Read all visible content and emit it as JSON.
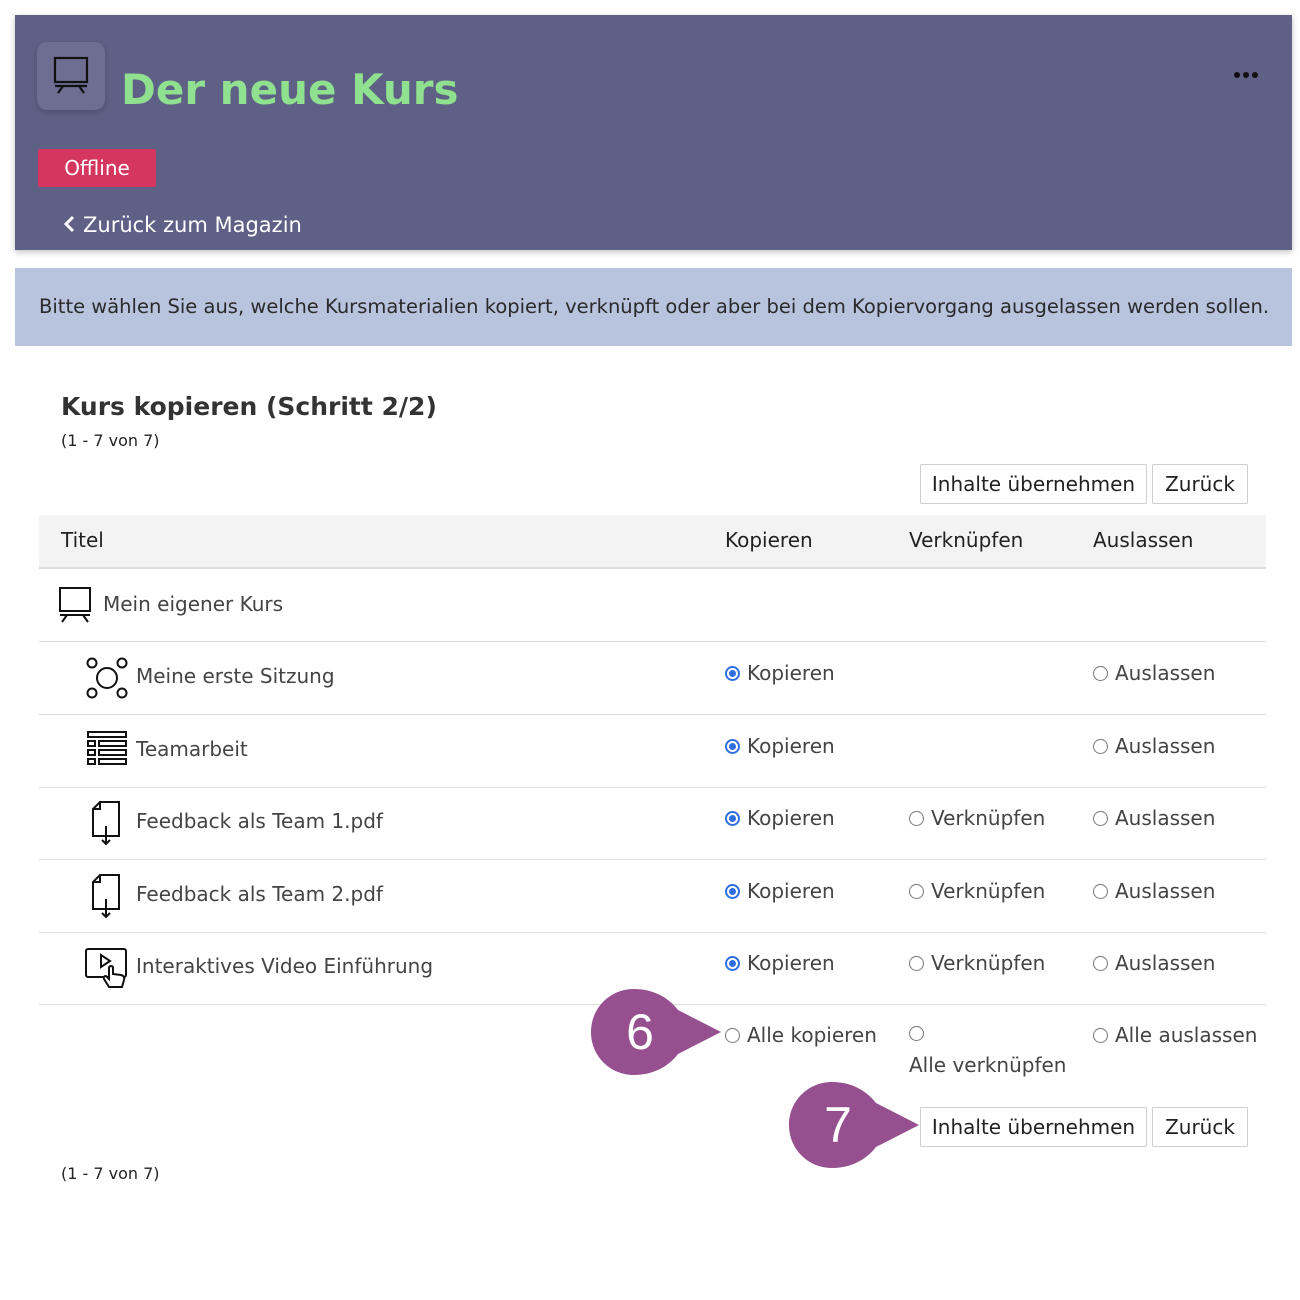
{
  "header": {
    "title": "Der neue Kurs",
    "status_badge": "Offline",
    "back_link": "Zurück zum Magazin",
    "more_icon": "more-horizontal-icon",
    "course_icon": "presentation-board-icon",
    "colors": {
      "background": "#5f6085",
      "title": "#8fe08f",
      "badge": "#d4365f"
    }
  },
  "info_message": "Bitte wählen Sie aus, welche Kursmaterialien kopiert, verknüpft oder aber bei dem Kopiervorgang ausgelassen werden sollen.",
  "page": {
    "heading": "Kurs kopieren (Schritt 2/2)",
    "count_top": "(1 - 7 von 7)",
    "count_bottom": "(1 - 7 von 7)"
  },
  "buttons": {
    "apply": "Inhalte übernehmen",
    "back": "Zurück"
  },
  "table": {
    "columns": [
      "Titel",
      "Kopieren",
      "Verknüpfen",
      "Auslassen"
    ],
    "rows": [
      {
        "title": "Mein eigener Kurs",
        "icon": "presentation-board-icon"
      },
      {
        "title": "Meine erste Sitzung",
        "icon": "session-network-icon",
        "options": [
          "Kopieren",
          "Auslassen"
        ],
        "selected": "Kopieren"
      },
      {
        "title": "Teamarbeit",
        "icon": "list-table-icon",
        "options": [
          "Kopieren",
          "Auslassen"
        ],
        "selected": "Kopieren"
      },
      {
        "title": "Feedback als Team 1.pdf",
        "icon": "file-download-icon",
        "options": [
          "Kopieren",
          "Verknüpfen",
          "Auslassen"
        ],
        "selected": "Kopieren"
      },
      {
        "title": "Feedback als Team 2.pdf",
        "icon": "file-download-icon",
        "options": [
          "Kopieren",
          "Verknüpfen",
          "Auslassen"
        ],
        "selected": "Kopieren"
      },
      {
        "title": "Interaktives Video Einführung",
        "icon": "interactive-video-icon",
        "options": [
          "Kopieren",
          "Verknüpfen",
          "Auslassen"
        ],
        "selected": "Kopieren"
      }
    ],
    "bulk": {
      "copy_all": "Alle kopieren",
      "link_all": "Alle verknüpfen",
      "skip_all": "Alle auslassen"
    }
  },
  "callouts": [
    {
      "number": "6",
      "color": "#96508f"
    },
    {
      "number": "7",
      "color": "#96508f"
    }
  ],
  "accent_color": "#2f6fe0"
}
